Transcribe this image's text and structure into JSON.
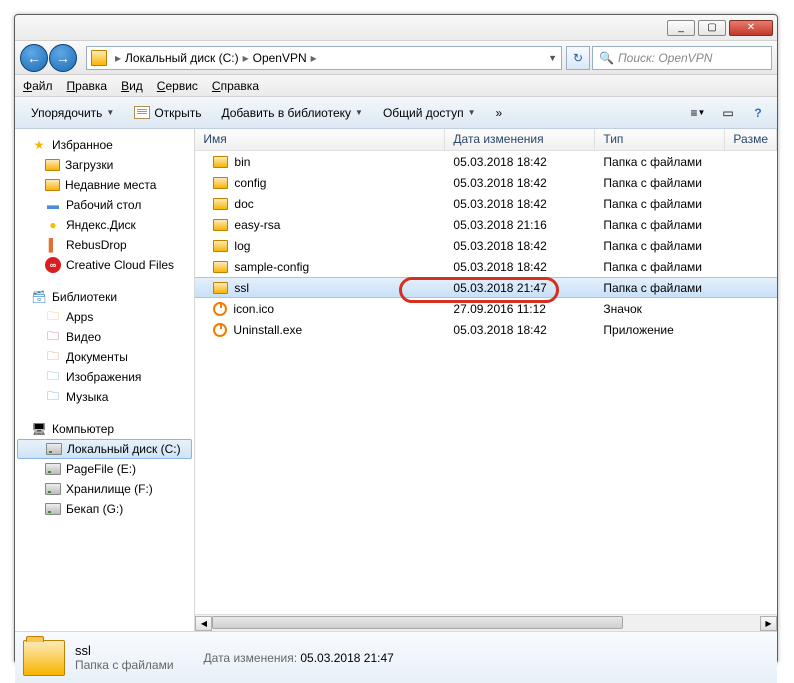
{
  "window": {
    "min": "_",
    "max": "▢",
    "close": "✕"
  },
  "address": {
    "seg1": "Локальный диск (C:)",
    "seg2": "OpenVPN"
  },
  "search": {
    "placeholder": "Поиск: OpenVPN"
  },
  "menu": {
    "file": "Файл",
    "edit": "Правка",
    "view": "Вид",
    "service": "Сервис",
    "help": "Справка"
  },
  "toolbar": {
    "organize": "Упорядочить",
    "open": "Открыть",
    "library": "Добавить в библиотеку",
    "share": "Общий доступ"
  },
  "nav": {
    "fav": "Избранное",
    "fav_items": [
      "Загрузки",
      "Недавние места",
      "Рабочий стол",
      "Яндекс.Диск",
      "RebusDrop",
      "Creative Cloud Files"
    ],
    "libs": "Библиотеки",
    "lib_items": [
      "Apps",
      "Видео",
      "Документы",
      "Изображения",
      "Музыка"
    ],
    "comp": "Компьютер",
    "comp_items": [
      "Локальный диск (C:)",
      "PageFile (E:)",
      "Хранилище (F:)",
      "Бекап (G:)"
    ]
  },
  "columns": {
    "name": "Имя",
    "date": "Дата изменения",
    "type": "Тип",
    "size": "Разме"
  },
  "files": [
    {
      "name": "bin",
      "date": "05.03.2018 18:42",
      "type": "Папка с файлами",
      "icon": "folder"
    },
    {
      "name": "config",
      "date": "05.03.2018 18:42",
      "type": "Папка с файлами",
      "icon": "folder"
    },
    {
      "name": "doc",
      "date": "05.03.2018 18:42",
      "type": "Папка с файлами",
      "icon": "folder"
    },
    {
      "name": "easy-rsa",
      "date": "05.03.2018 21:16",
      "type": "Папка с файлами",
      "icon": "folder"
    },
    {
      "name": "log",
      "date": "05.03.2018 18:42",
      "type": "Папка с файлами",
      "icon": "folder"
    },
    {
      "name": "sample-config",
      "date": "05.03.2018 18:42",
      "type": "Папка с файлами",
      "icon": "folder"
    },
    {
      "name": "ssl",
      "date": "05.03.2018 21:47",
      "type": "Папка с файлами",
      "icon": "folder",
      "selected": true
    },
    {
      "name": "icon.ico",
      "date": "27.09.2016 11:12",
      "type": "Значок",
      "icon": "ov"
    },
    {
      "name": "Uninstall.exe",
      "date": "05.03.2018 18:42",
      "type": "Приложение",
      "icon": "ov"
    }
  ],
  "status": {
    "name": "ssl",
    "date_label": "Дата изменения:",
    "date": "05.03.2018 21:47",
    "type": "Папка с файлами"
  }
}
